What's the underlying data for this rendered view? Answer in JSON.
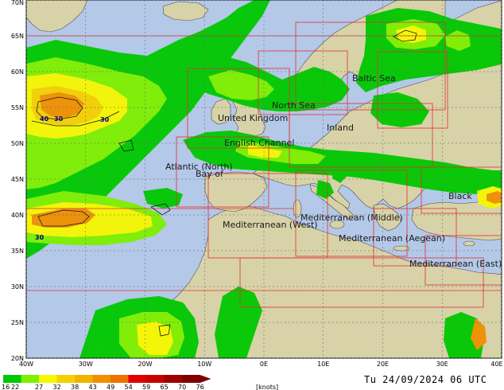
{
  "map": {
    "lon_labels": [
      "40W",
      "30W",
      "20W",
      "10W",
      "0E",
      "10E",
      "20E",
      "30E",
      "40E"
    ],
    "lat_labels": [
      "70N",
      "65N",
      "60N",
      "55N",
      "50N",
      "45N",
      "40N",
      "35N",
      "30N",
      "25N",
      "20N"
    ],
    "lon_range": [
      -40,
      40
    ],
    "lat_range": [
      20,
      70
    ],
    "contour_labels": [
      "40",
      "30",
      "30",
      "30"
    ],
    "region_names": [
      "Baltic Sea",
      "North Sea",
      "United Kingdom",
      "Inland",
      "English Channel",
      "Atlantic (North)",
      "Bay of",
      "Black",
      "Mediterranean (Middle)",
      "Mediterranean (West)",
      "Mediterranean (Aegean)",
      "Mediterranean (East)"
    ]
  },
  "legend": {
    "values": [
      "16",
      "22",
      "27",
      "32",
      "38",
      "43",
      "49",
      "54",
      "59",
      "65",
      "70",
      "76"
    ],
    "unit": "[knots]",
    "colors": [
      "#00c800",
      "#7ef000",
      "#f7f700",
      "#f5d000",
      "#f0b400",
      "#f09000",
      "#f07000",
      "#e00000",
      "#c80000",
      "#a00000",
      "#800000"
    ]
  },
  "footer": {
    "timestamp": "Tu 24/09/2024 06 UTC"
  },
  "style": {
    "land_color": "#d8d2a8",
    "sea_color": "#b4c8e8",
    "region_box_color": "#e03030",
    "grid_color": "#606060"
  }
}
